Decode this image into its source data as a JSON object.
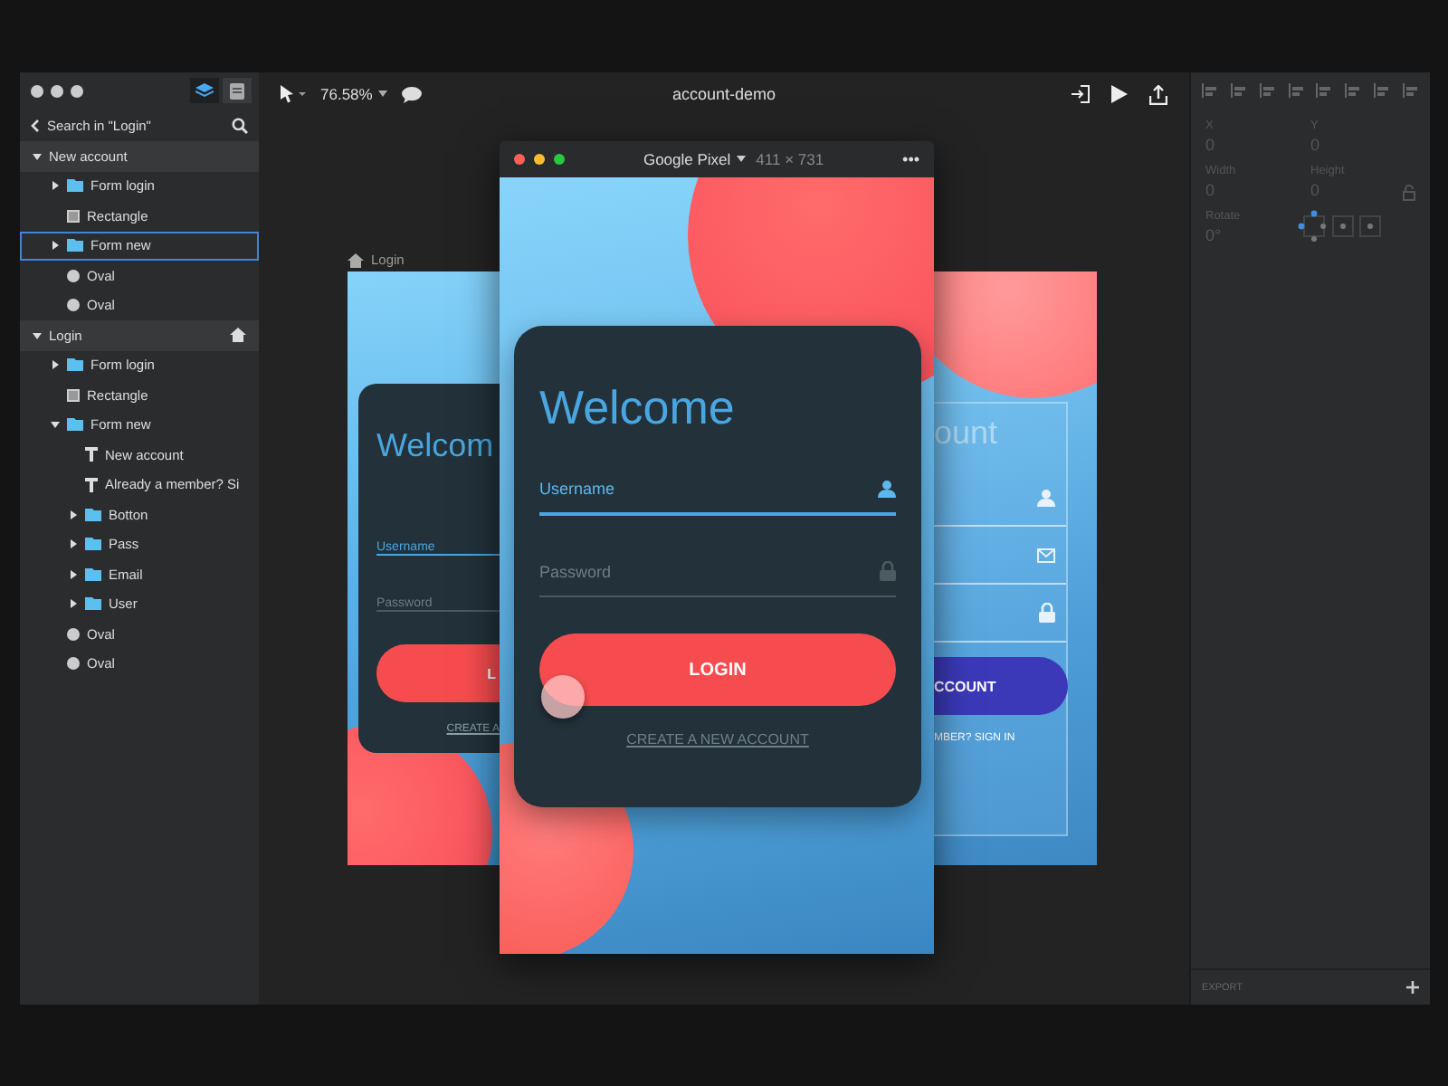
{
  "app": {
    "title": "account-demo",
    "zoom": "76.58%"
  },
  "sidebar": {
    "tabs": [
      {
        "kind": "layers",
        "selected": true
      },
      {
        "kind": "document",
        "selected": false
      }
    ],
    "search_label": "Search in \"Login\"",
    "layers": [
      {
        "name": "New account",
        "kind": "artboard",
        "home": false,
        "expanded": true,
        "selected": false,
        "children": [
          {
            "name": "Form login",
            "kind": "folder",
            "expanded": false,
            "selected": false
          },
          {
            "name": "Rectangle",
            "kind": "rect",
            "selected": false
          },
          {
            "name": "Form new",
            "kind": "folder",
            "expanded": false,
            "selected": true
          },
          {
            "name": "Oval",
            "kind": "oval",
            "selected": false
          },
          {
            "name": "Oval",
            "kind": "oval",
            "selected": false
          }
        ]
      },
      {
        "name": "Login",
        "kind": "artboard",
        "home": true,
        "expanded": true,
        "selected": false,
        "children": [
          {
            "name": "Form login",
            "kind": "folder",
            "expanded": false,
            "selected": false
          },
          {
            "name": "Rectangle",
            "kind": "rect",
            "selected": false
          },
          {
            "name": "Form new",
            "kind": "folder",
            "expanded": true,
            "selected": false,
            "children": [
              {
                "name": "New account",
                "kind": "text",
                "selected": false
              },
              {
                "name": "Already a member? Si",
                "kind": "text",
                "selected": false
              },
              {
                "name": "Botton",
                "kind": "folder",
                "expanded": false,
                "selected": false
              },
              {
                "name": "Pass",
                "kind": "folder",
                "expanded": false,
                "selected": false
              },
              {
                "name": "Email",
                "kind": "folder",
                "expanded": false,
                "selected": false
              },
              {
                "name": "User",
                "kind": "folder",
                "expanded": false,
                "selected": false
              }
            ]
          },
          {
            "name": "Oval",
            "kind": "oval",
            "selected": false
          },
          {
            "name": "Oval",
            "kind": "oval",
            "selected": false
          }
        ]
      }
    ]
  },
  "canvas": {
    "left_artboard": {
      "label": "Login",
      "title": "Welcom",
      "fields": [
        {
          "placeholder": "Username",
          "focused": true
        },
        {
          "placeholder": "Password",
          "focused": false
        }
      ],
      "button": "L",
      "link": "CREATE A"
    },
    "right_artboard": {
      "title": "ount",
      "fields": [
        {
          "kind": "user"
        },
        {
          "kind": "mail"
        },
        {
          "kind": "lock"
        }
      ],
      "button": "CCOUNT",
      "link": "MBER? SIGN IN"
    },
    "device": {
      "name": "Google Pixel",
      "size": "411 × 731",
      "menu": "•••",
      "title": "Welcome",
      "fields": [
        {
          "placeholder": "Username",
          "focused": true,
          "kind": "user"
        },
        {
          "placeholder": "Password",
          "focused": false,
          "kind": "lock"
        }
      ],
      "button": "LOGIN",
      "link": "CREATE A NEW ACCOUNT"
    }
  },
  "inspector": {
    "fields": [
      {
        "label": "X",
        "value": "0"
      },
      {
        "label": "Y",
        "value": "0"
      },
      {
        "label": "Width",
        "value": "0"
      },
      {
        "label": "Height",
        "value": "0"
      }
    ],
    "rotate": {
      "label": "Rotate",
      "value": "0°"
    },
    "export": "EXPORT"
  }
}
